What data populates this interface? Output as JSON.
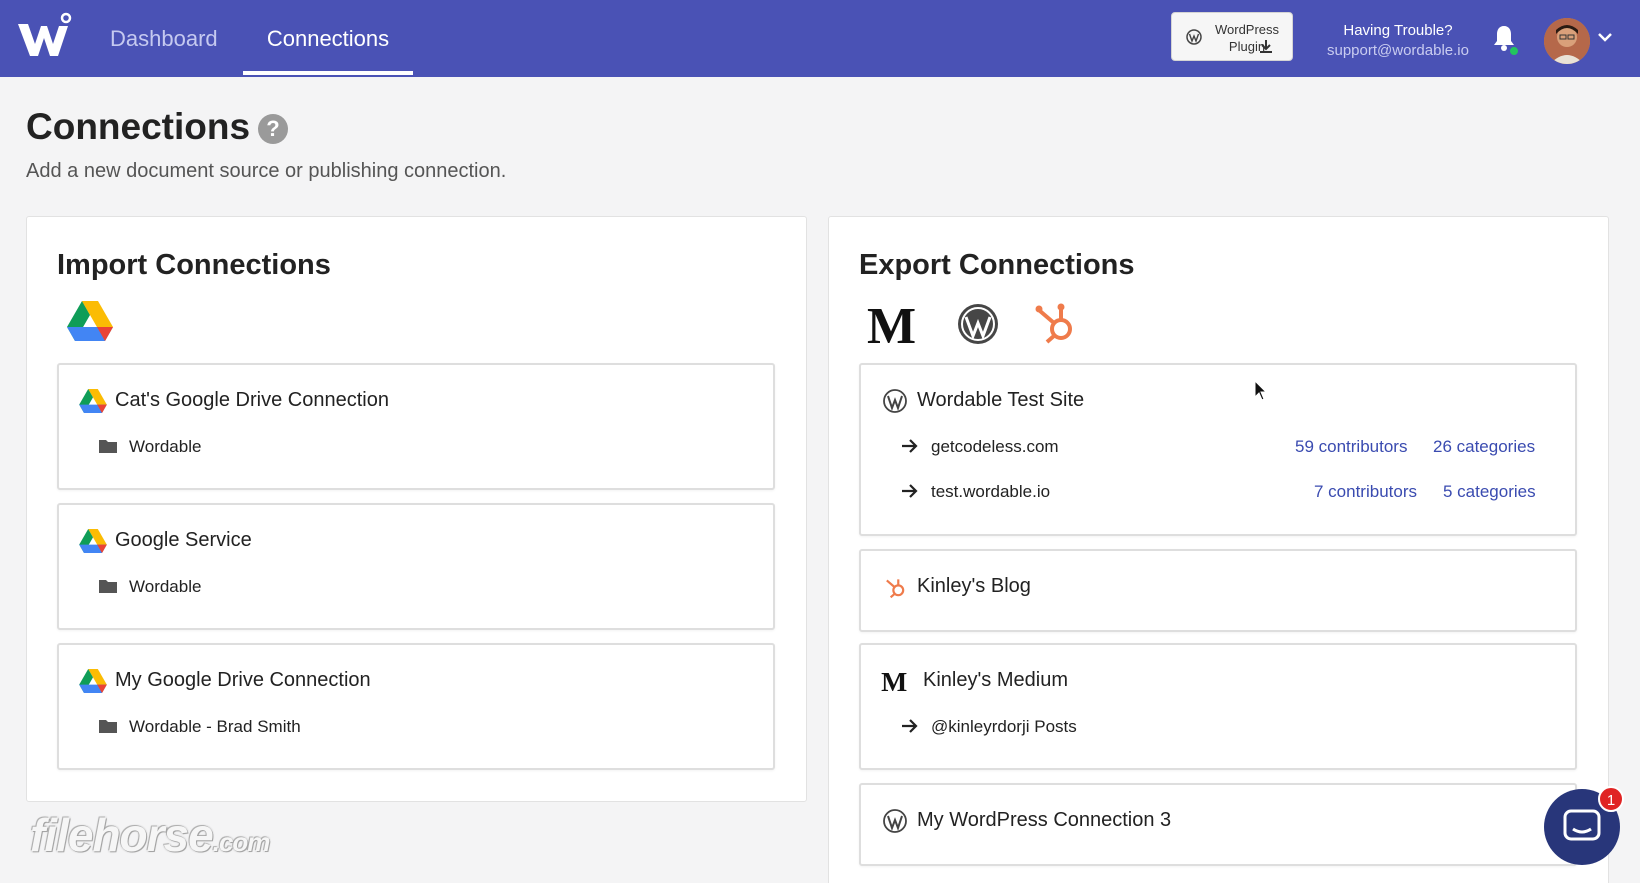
{
  "nav": {
    "dashboard": "Dashboard",
    "connections": "Connections"
  },
  "header": {
    "plugin_line1": "WordPress",
    "plugin_line2": "Plugin",
    "trouble": "Having Trouble?",
    "support_email": "support@wordable.io"
  },
  "page": {
    "title": "Connections",
    "help": "?",
    "subtitle": "Add a new document source or publishing connection."
  },
  "import": {
    "title": "Import Connections",
    "cards": [
      {
        "title": "Cat's Google Drive Connection",
        "folder": "Wordable"
      },
      {
        "title": "Google Service",
        "folder": "Wordable"
      },
      {
        "title": "My Google Drive Connection",
        "folder": "Wordable - Brad Smith"
      }
    ]
  },
  "export": {
    "title": "Export Connections",
    "cards": [
      {
        "title": "Wordable Test Site",
        "sites": [
          {
            "name": "getcodeless.com",
            "contributors": "59 contributors",
            "categories": "26 categories"
          },
          {
            "name": "test.wordable.io",
            "contributors": "7 contributors",
            "categories": "5 categories"
          }
        ]
      },
      {
        "title": "Kinley's Blog"
      },
      {
        "title": "Kinley's Medium",
        "sub": "@kinleyrdorji Posts"
      },
      {
        "title": "My WordPress Connection 3"
      }
    ]
  },
  "watermark": {
    "main": "filehorse",
    "suffix": ".com"
  },
  "chat": {
    "badge": "1"
  },
  "colors": {
    "nav_bg": "#4a52b5",
    "link": "#3a4bb0",
    "hubspot": "#ef7b4b",
    "chat_bg": "#28367a",
    "badge": "#e02424"
  }
}
